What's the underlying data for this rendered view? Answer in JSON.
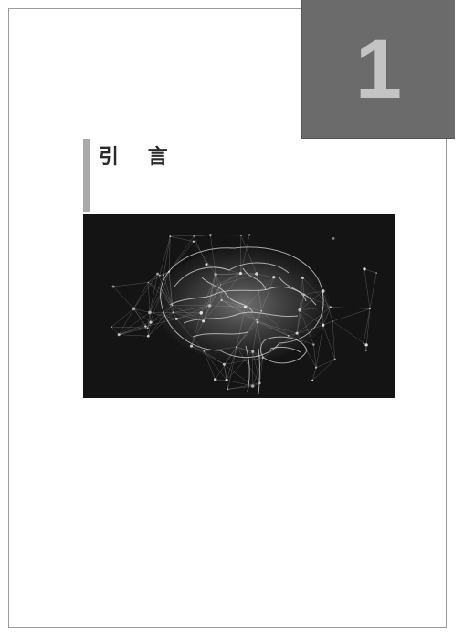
{
  "chapter": {
    "number": "1",
    "title": "引 言"
  },
  "figure": {
    "icon": "brain-network-icon",
    "background_color": "#141414"
  },
  "colors": {
    "chapter_block": "#6b6b6b",
    "chapter_number": "#c4c4c4",
    "title_bar": "#a9a9a9",
    "title_text": "#2a2a2a"
  }
}
